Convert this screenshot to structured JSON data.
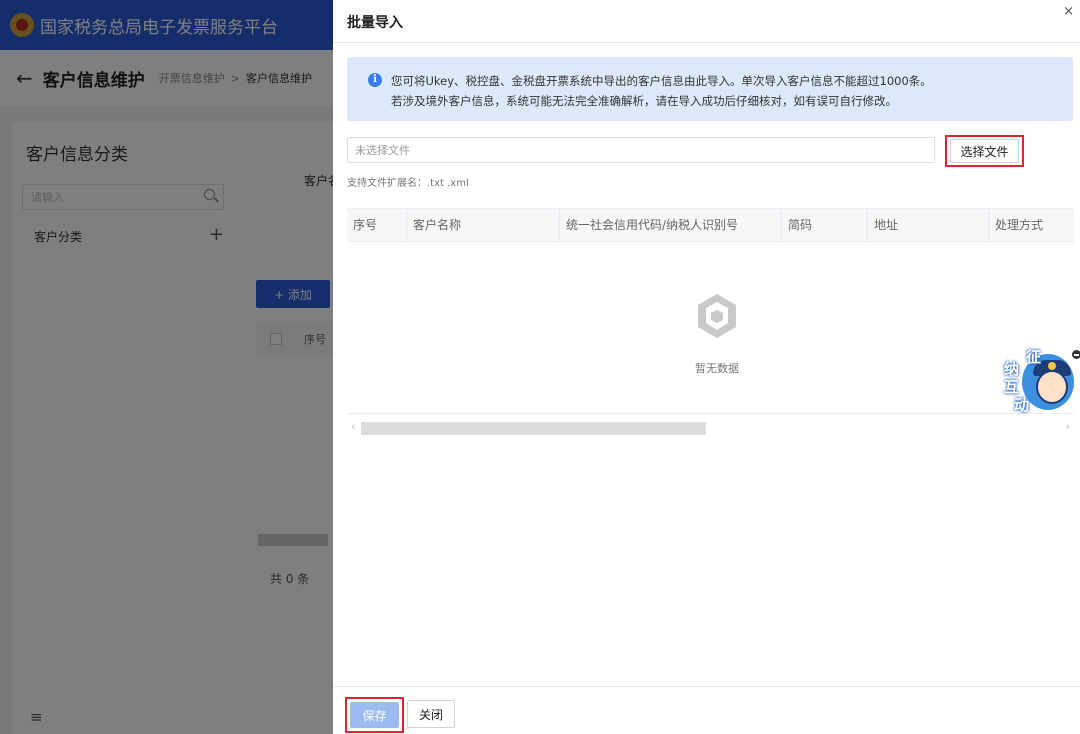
{
  "app": {
    "title": "国家税务总局电子发票服务平台"
  },
  "header": {
    "page_title": "客户信息维护",
    "breadcrumb": [
      "开票信息维护",
      "客户信息维护"
    ],
    "breadcrumb_sep": ">"
  },
  "sidebar": {
    "title": "客户信息分类",
    "search_placeholder": "请输入",
    "category": "客户分类",
    "add_symbol": "+",
    "fold_icon": "≡"
  },
  "content": {
    "customer_label": "客户名",
    "add_button": "+ 添加",
    "seq_header": "序号",
    "total": "共 0 条"
  },
  "drawer": {
    "title": "批量导入",
    "close_symbol": "×",
    "info_line1": "您可将Ukey、税控盘、金税盘开票系统中导出的客户信息由此导入。单次导入客户信息不能超过1000条。",
    "info_line2": "若涉及境外客户信息，系统可能无法完全准确解析，请在导入成功后仔细核对，如有误可自行修改。",
    "file_placeholder": "未选择文件",
    "choose_button": "选择文件",
    "ext_hint": "支持文件扩展名：.txt .xml",
    "columns": [
      "序号",
      "客户名称",
      "统一社会信用代码/纳税人识别号",
      "简码",
      "地址",
      "处理方式"
    ],
    "empty_text": "暂无数据",
    "save_button": "保存",
    "close_button": "关闭"
  },
  "helper": {
    "chars": [
      "征",
      "纳",
      "互",
      "动"
    ]
  },
  "colors": {
    "primary": "#2a5bd6",
    "highlight": "#e0262b",
    "info_bg": "#dde9fa",
    "save_disabled": "#9cbcf1"
  }
}
